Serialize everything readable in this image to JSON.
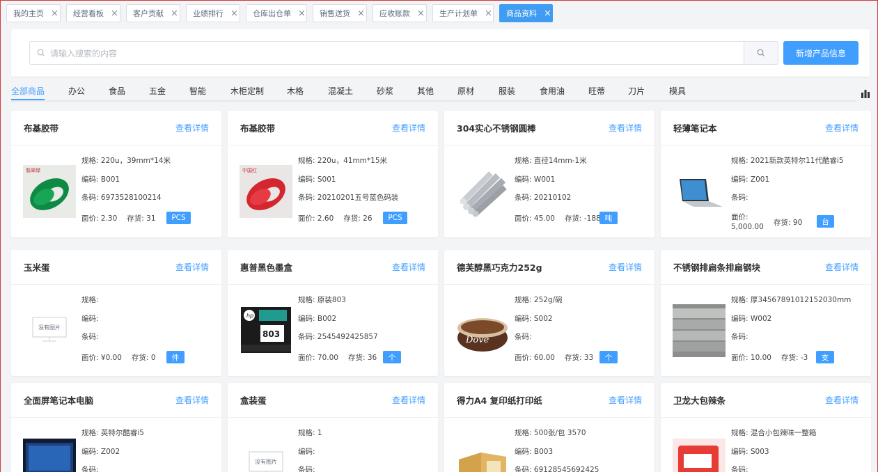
{
  "tabs": [
    {
      "label": "我的主页",
      "active": false
    },
    {
      "label": "经营看板",
      "active": false
    },
    {
      "label": "客户贡献",
      "active": false
    },
    {
      "label": "业绩排行",
      "active": false
    },
    {
      "label": "仓库出仓单",
      "active": false
    },
    {
      "label": "销售送货",
      "active": false
    },
    {
      "label": "应收账款",
      "active": false
    },
    {
      "label": "生产计划单",
      "active": false
    },
    {
      "label": "商品资料",
      "active": true
    }
  ],
  "search": {
    "placeholder": "请输入搜索的内容",
    "value": ""
  },
  "add_button": "新增产品信息",
  "categories": [
    "全部商品",
    "办公",
    "食品",
    "五金",
    "智能",
    "木柜定制",
    "木格",
    "混凝土",
    "砂浆",
    "其他",
    "原材",
    "服装",
    "食用油",
    "旺蒂",
    "刀片",
    "模具"
  ],
  "active_category": "全部商品",
  "labels": {
    "detail": "查看详情",
    "spec": "规格:",
    "code": "编码:",
    "barcode": "条码:",
    "price": "面价:",
    "stock": "存货:",
    "no_image": "没有图片"
  },
  "products": [
    {
      "name": "布基胶带",
      "spec": "220u，39mm*14米",
      "code": "B001",
      "barcode": "6973528100214",
      "price": "2.30",
      "stock": "31",
      "unit": "PCS",
      "image": "green-tape",
      "image_label": "翡翠绿"
    },
    {
      "name": "布基胶带",
      "spec": "220u，41mm*15米",
      "code": "S001",
      "barcode": "20210201五号蓝色码装",
      "price": "2.60",
      "stock": "26",
      "unit": "PCS",
      "image": "red-tape",
      "image_label": "中国红"
    },
    {
      "name": "304实心不锈钢圆棒",
      "spec": "直径14mm-1米",
      "code": "W001",
      "barcode": "20210102",
      "price": "45.00",
      "stock": "-188",
      "unit": "吨",
      "image": "steel-rods"
    },
    {
      "name": "轻薄笔记本",
      "spec": "2021新款英特尔11代酷睿i5",
      "code": "Z001",
      "barcode": "",
      "price": "5,000.00",
      "stock": "90",
      "unit": "台",
      "image": "laptop"
    },
    {
      "name": "玉米蛋",
      "spec": "",
      "code": "",
      "barcode": "",
      "price": "¥0.00",
      "stock": "0",
      "unit": "件",
      "image": "none"
    },
    {
      "name": "惠普黑色墨盒",
      "spec": "原装803",
      "code": "B002",
      "barcode": "2545492425857",
      "price": "70.00",
      "stock": "36",
      "unit": "个",
      "image": "ink-cartridge",
      "image_label": "803"
    },
    {
      "name": "德芙醇黑巧克力252g",
      "spec": "252g/碗",
      "code": "S002",
      "barcode": "",
      "price": "60.00",
      "stock": "33",
      "unit": "个",
      "image": "chocolate",
      "image_label": "Dove"
    },
    {
      "name": "不锈钢排扁条排扁钢块",
      "spec": "厚34567891012152030mm",
      "code": "W002",
      "barcode": "",
      "price": "10.00",
      "stock": "-3",
      "unit": "支",
      "image": "flat-steel"
    },
    {
      "name": "全面屏笔记本电脑",
      "spec": "英特尔酷睿i5",
      "code": "Z002",
      "barcode": "",
      "image": "screen-laptop"
    },
    {
      "name": "盒装蛋",
      "spec": "1",
      "code": "",
      "barcode": "",
      "image": "none"
    },
    {
      "name": "得力A4 复印纸打印纸",
      "spec": "500张/包 3570",
      "code": "B003",
      "barcode": "69128545692425",
      "image": "paper-box"
    },
    {
      "name": "卫龙大包辣条",
      "spec": "混合小包辣味一整箱",
      "code": "S003",
      "barcode": "",
      "image": "snack-bag"
    }
  ],
  "colors": {
    "accent": "#409eff",
    "frame_border": "#d23b3b"
  }
}
